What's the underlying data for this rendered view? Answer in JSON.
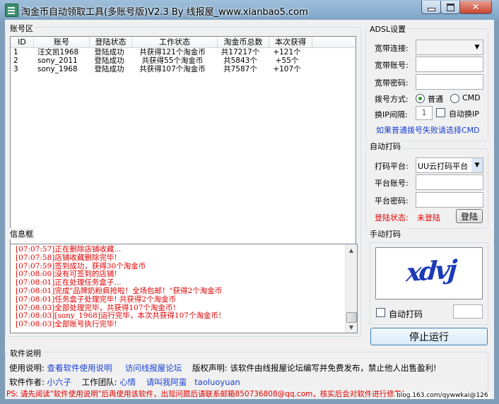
{
  "window": {
    "title": "淘金币自动领取工具(多账号版)V2.3 By 线报屋_www.xianbao5.com"
  },
  "accounts": {
    "group_title": "账号区",
    "columns": [
      "ID",
      "账号",
      "登陆状态",
      "工作状态",
      "淘金币总数",
      "本次获得"
    ],
    "rows": [
      [
        "1",
        "汪文凯1968",
        "登陆成功",
        "共获得121个淘金币",
        "共17217个",
        "+121个"
      ],
      [
        "2",
        "sony_2011",
        "登陆成功",
        "共获得55个淘金币",
        "共5843个",
        "+55个"
      ],
      [
        "3",
        "sony_1968",
        "登陆成功",
        "共获得107个淘金币",
        "共7587个",
        "+107个"
      ]
    ]
  },
  "adsl": {
    "group_title": "ADSL设置",
    "conn_label": "宽带连接:",
    "account_label": "宽带账号:",
    "password_label": "宽带密码:",
    "dial_mode_label": "拨号方式:",
    "radio_normal": "普通",
    "radio_cmd": "CMD",
    "interval_label": "换IP间隔:",
    "interval_value": "1",
    "auto_ip_label": "自动换IP",
    "hint": "如果普通拨号失败请选择CMD"
  },
  "captcha_auto": {
    "group_title": "自动打码",
    "platform_label": "打码平台:",
    "platform_value": "UU云打码平台",
    "account_label": "平台账号:",
    "password_label": "平台密码:",
    "login_status_label": "登陆状态:",
    "login_status_value": "未登陆",
    "login_button": "登陆"
  },
  "captcha_manual": {
    "group_title": "手动打码",
    "captcha_text": "xdvj",
    "auto_label": "自动打码"
  },
  "stop_button": "停止运行",
  "log": {
    "group_title": "信息框",
    "lines": [
      "[07:07:57]正在删除店铺收藏...",
      "[07:07:58]店铺收藏删除完毕!",
      "[07:07:59]签到成功，获得30个淘金币",
      "[07:08:00]没有可签到的店铺!",
      "[07:08:01]正在处理任务盒子...",
      "[07:08:01]完成\"品牌奶粉疯抢啦！全场包邮！\"获得2个淘金币",
      "[07:08:01]任务盒子处理完毕! 共获得2个淘金币",
      "[07:08:03]全部处理完毕，共获得107个淘金币!",
      "[07:08:03][sony_1968]运行完毕，本次共获得107个淘金币!",
      "[07:08:03]全部账号执行完毕!"
    ]
  },
  "info": {
    "group_title": "软件说明",
    "usage_label": "使用说明:",
    "usage_link": "查看软件使用说明",
    "forum_link": "访问线报屋论坛",
    "copyright": "版权声明: 该软件由线报屋论坛编写并免费发布，禁止他人出售盈利!",
    "author_label": "软件作者:",
    "author": "小六子",
    "team_label": "工作团队:",
    "team_a": "心情",
    "team_b": "请叫我阿蛮",
    "team_c": "taoluoyuan",
    "ps": "PS: 请先阅读\"软件使用说明\"后再使用该软件，出现问题后请联系邮箱850736808@qq.com，核实后会对软件进行修复!",
    "watermark": "blog.163.com/qywwkai@126"
  },
  "colors": {
    "accent_red": "#e00000",
    "link_blue": "#1a3fcf",
    "window_frame": "#7f9db8"
  }
}
